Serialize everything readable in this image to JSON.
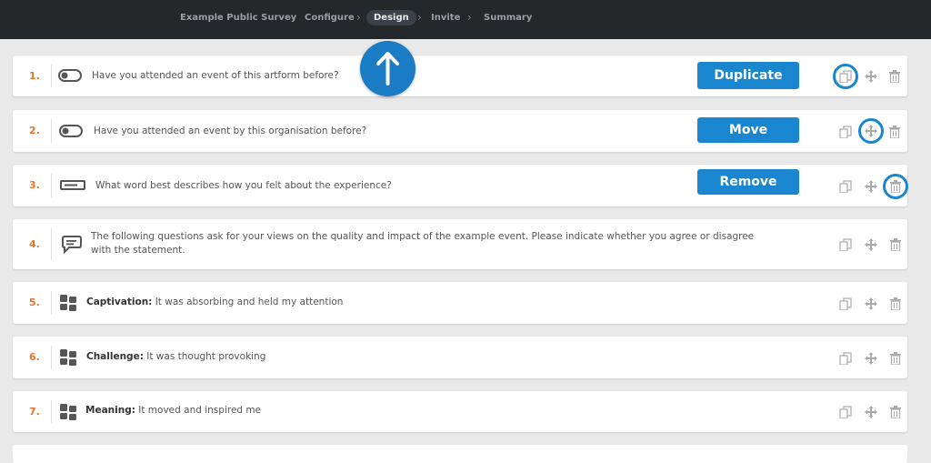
{
  "breadcrumbs": [
    {
      "label": "Example Public Survey"
    },
    {
      "label": "Configure"
    },
    {
      "label": "Design",
      "active": true
    },
    {
      "label": "Invite"
    },
    {
      "label": "Summary"
    }
  ],
  "separator": "›",
  "questions": [
    {
      "number": "1.",
      "icon": "toggle-icon",
      "bold": "",
      "text": "Have you attended an event of this artform before?"
    },
    {
      "number": "2.",
      "icon": "toggle-icon",
      "bold": "",
      "text": "Have you attended an event by this organisation before?"
    },
    {
      "number": "3.",
      "icon": "text-field-icon",
      "bold": "",
      "text": "What word best describes how you felt about the experience?"
    },
    {
      "number": "4.",
      "icon": "speech-bubble-icon",
      "bold": "",
      "text": "The following questions ask for your views on the quality and impact of the example event. Please indicate whether you agree or disagree with the statement."
    },
    {
      "number": "5.",
      "icon": "grid-icon",
      "bold": "Captivation:",
      "text": " It was absorbing and held my attention"
    },
    {
      "number": "6.",
      "icon": "grid-icon",
      "bold": "Challenge:",
      "text": " It was thought provoking"
    },
    {
      "number": "7.",
      "icon": "grid-icon",
      "bold": "Meaning:",
      "text": " It moved and inspired me"
    }
  ],
  "annotations": {
    "duplicate": "Duplicate",
    "move": "Move",
    "remove": "Remove"
  },
  "colors": {
    "accent": "#1a86d0",
    "number": "#e8742a",
    "topbar": "#25282b"
  }
}
